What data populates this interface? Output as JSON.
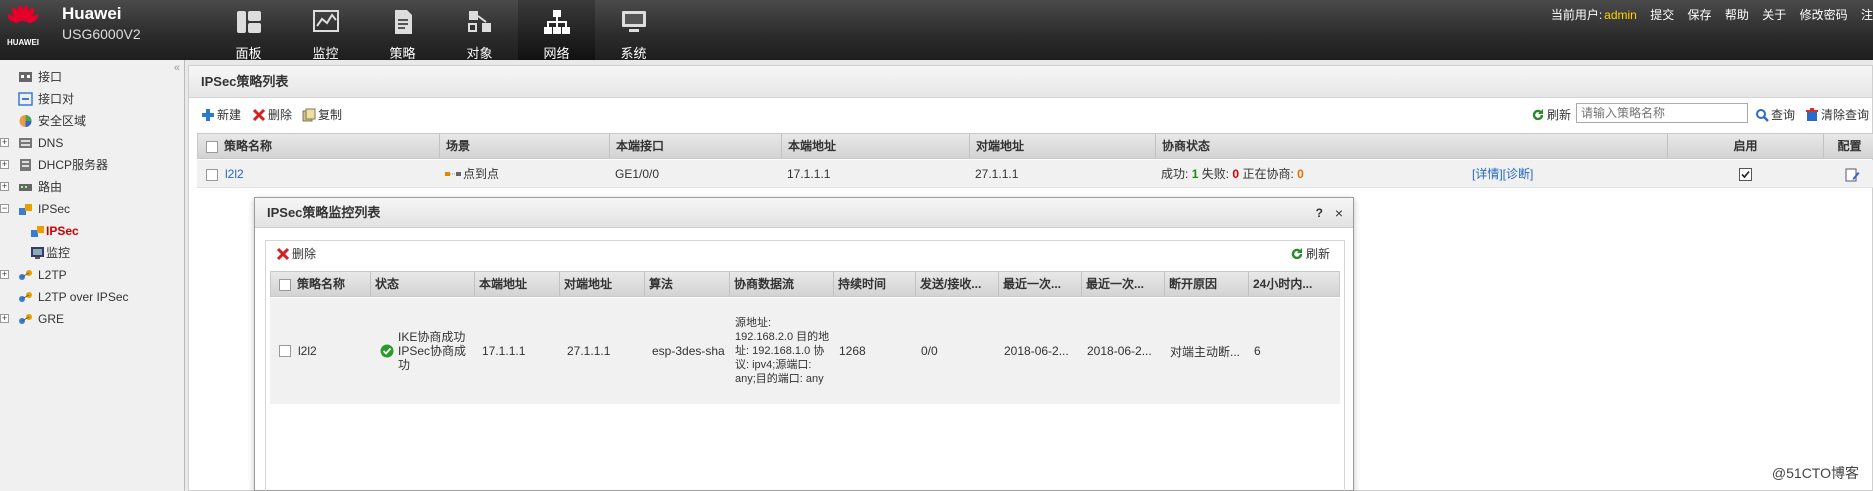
{
  "header": {
    "logo_text": "HUAWEI",
    "brand_name": "Huawei",
    "brand_model": "USG6000V2",
    "nav": [
      {
        "label": "面板",
        "icon": "dashboard-icon"
      },
      {
        "label": "监控",
        "icon": "monitor-chart-icon"
      },
      {
        "label": "策略",
        "icon": "policy-document-icon"
      },
      {
        "label": "对象",
        "icon": "objects-icon"
      },
      {
        "label": "网络",
        "icon": "network-topology-icon"
      },
      {
        "label": "系统",
        "icon": "system-computer-icon"
      }
    ],
    "active_nav": "网络",
    "current_user_label": "当前用户:",
    "current_user": "admin",
    "links": [
      "提交",
      "保存",
      "帮助",
      "关于",
      "修改密码",
      "注"
    ]
  },
  "sidebar": {
    "collapse_glyph": "«",
    "items": [
      {
        "label": "接口",
        "icon": "interface-icon",
        "expandable": false
      },
      {
        "label": "接口对",
        "icon": "interface-pair-icon",
        "expandable": false
      },
      {
        "label": "安全区域",
        "icon": "security-zone-icon",
        "expandable": false
      },
      {
        "label": "DNS",
        "icon": "dns-icon",
        "expandable": true,
        "exp_glyph": "+"
      },
      {
        "label": "DHCP服务器",
        "icon": "dhcp-server-icon",
        "expandable": true,
        "exp_glyph": "+"
      },
      {
        "label": "路由",
        "icon": "router-icon",
        "expandable": true,
        "exp_glyph": "+"
      },
      {
        "label": "IPSec",
        "icon": "ipsec-icon",
        "expandable": true,
        "exp_glyph": "−"
      },
      {
        "label": "IPSec",
        "icon": "ipsec-icon",
        "selected": true,
        "child": true
      },
      {
        "label": "监控",
        "icon": "monitor-icon",
        "child": true
      },
      {
        "label": "L2TP",
        "icon": "l2tp-icon",
        "expandable": true,
        "exp_glyph": "+"
      },
      {
        "label": "L2TP over IPSec",
        "icon": "l2tp-over-ipsec-icon",
        "expandable": false
      },
      {
        "label": "GRE",
        "icon": "gre-icon",
        "expandable": true,
        "exp_glyph": "+"
      }
    ]
  },
  "main": {
    "title": "IPSec策略列表",
    "toolbar": {
      "new": "新建",
      "delete": "删除",
      "copy": "复制",
      "refresh": "刷新",
      "query": "查询",
      "clear_query": "清除查询"
    },
    "search_placeholder": "请输入策略名称",
    "columns": [
      "策略名称",
      "场景",
      "本端接口",
      "本端地址",
      "对端地址",
      "协商状态",
      "启用",
      "配置"
    ],
    "rows": [
      {
        "name": "l2l2",
        "scene": "点到点",
        "local_if": "GE1/0/0",
        "local_addr": "17.1.1.1",
        "peer_addr": "27.1.1.1",
        "success_label": "成功:",
        "success": "1",
        "fail_label": "失败:",
        "fail": "0",
        "negotiating_label": "正在协商:",
        "negotiating": "0",
        "detail_links": "[详情][诊断]",
        "enabled": true
      }
    ]
  },
  "dialog": {
    "title": "IPSec策略监控列表",
    "help": "?",
    "close": "×",
    "toolbar": {
      "delete": "删除",
      "refresh": "刷新"
    },
    "columns": [
      "策略名称",
      "状态",
      "本端地址",
      "对端地址",
      "算法",
      "协商数据流",
      "持续时间",
      "发送/接收...",
      "最近一次...",
      "最近一次...",
      "断开原因",
      "24小时内..."
    ],
    "rows": [
      {
        "name": "l2l2",
        "status": "IKE协商成功 IPSec协商成功",
        "local_addr": "17.1.1.1",
        "peer_addr": "27.1.1.1",
        "algorithm": "esp-3des-sha",
        "flow": "源地址: 192.168.2.0 目的地址: 192.168.1.0 协议: ipv4;源端口: any;目的端口: any",
        "duration": "1268",
        "send_recv": "0/0",
        "last1": "2018-06-2...",
        "last2": "2018-06-2...",
        "disconnect_reason": "对端主动断...",
        "count24h": "6"
      }
    ]
  },
  "watermark": "@51CTO博客",
  "colors": {
    "accent_link": "#2268c8",
    "success": "#1a8a1a",
    "fail": "#d40000",
    "negotiating": "#e07000",
    "selected_tree": "#cc0000",
    "user": "#ffd400"
  }
}
